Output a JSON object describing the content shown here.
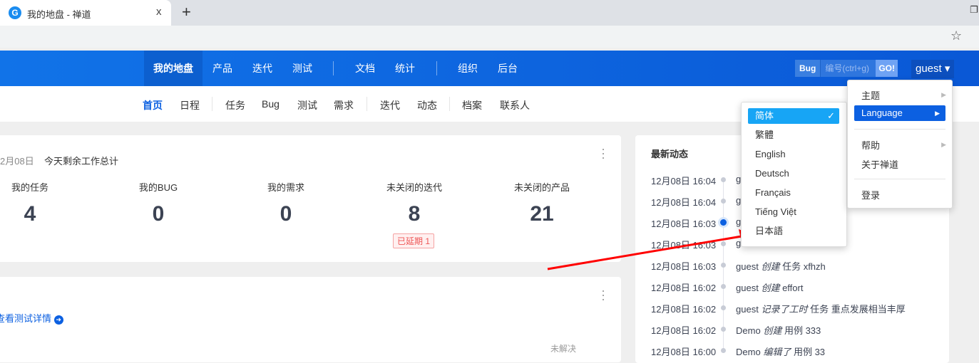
{
  "browser": {
    "tab_title": "我的地盘 - 禅道",
    "close": "x",
    "new_tab": "+",
    "star": "☆",
    "restore": "❐"
  },
  "header": {
    "nav": [
      "我的地盘",
      "产品",
      "迭代",
      "测试",
      "文档",
      "统计",
      "组织",
      "后台"
    ],
    "search": {
      "type": "Bug",
      "placeholder": "编号(ctrl+g)",
      "go": "GO!"
    },
    "user": "guest ▾"
  },
  "subnav": [
    "首页",
    "日程",
    "任务",
    "Bug",
    "测试",
    "需求",
    "迭代",
    "动态",
    "档案",
    "联系人"
  ],
  "summary": {
    "date": "2月08日",
    "title": "今天剩余工作总计",
    "stats": [
      {
        "label": "我的任务",
        "value": "4"
      },
      {
        "label": "我的BUG",
        "value": "0"
      },
      {
        "label": "我的需求",
        "value": "0"
      },
      {
        "label": "未关闭的迭代",
        "value": "8"
      },
      {
        "label": "未关闭的产品",
        "value": "21"
      }
    ],
    "badge": "已延期 1"
  },
  "test_card": {
    "link": "查看测试详情",
    "partial": "未解决"
  },
  "activity": {
    "title": "最新动态",
    "items": [
      {
        "time": "12月08日 16:04",
        "actor": "g",
        "action": "",
        "target": ""
      },
      {
        "time": "12月08日 16:04",
        "actor": "g",
        "action": "",
        "target": ""
      },
      {
        "time": "12月08日 16:03",
        "actor": "g",
        "action": "",
        "target": ""
      },
      {
        "time": "12月08日 16:03",
        "actor": "g",
        "action": "",
        "target": ""
      },
      {
        "time": "12月08日 16:03",
        "actor": "guest",
        "action": "创建",
        "target": "任务 xfhzh"
      },
      {
        "time": "12月08日 16:02",
        "actor": "guest",
        "action": "创建",
        "target": "effort"
      },
      {
        "time": "12月08日 16:02",
        "actor": "guest",
        "action": "记录了工时",
        "target": "任务 重点发展相当丰厚"
      },
      {
        "time": "12月08日 16:02",
        "actor": "Demo",
        "action": "创建",
        "target": "用例 333"
      },
      {
        "time": "12月08日 16:00",
        "actor": "Demo",
        "action": "编辑了",
        "target": "用例 33"
      }
    ]
  },
  "user_menu": {
    "items": [
      "主题",
      "Language",
      "帮助",
      "关于禅道",
      "登录"
    ]
  },
  "language_menu": {
    "items": [
      "简体",
      "繁體",
      "English",
      "Deutsch",
      "Français",
      "Tiếng Việt",
      "日本語"
    ],
    "selected": "简体",
    "check": "✓"
  }
}
